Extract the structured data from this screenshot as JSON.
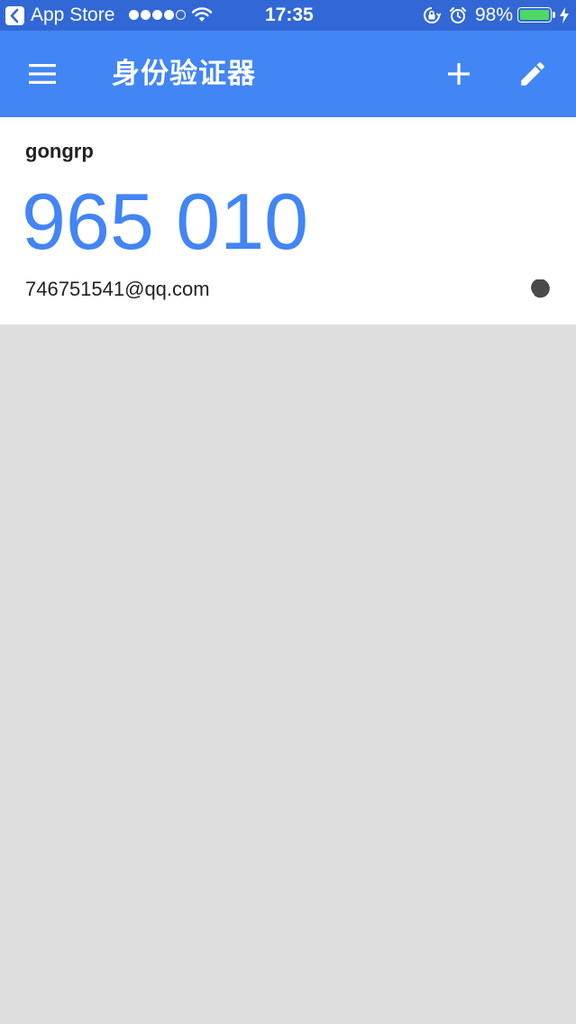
{
  "status_bar": {
    "back_app": "App Store",
    "time": "17:35",
    "battery_percent": "98%",
    "signal_bars_filled": 4,
    "signal_bars_total": 5,
    "battery_level": 0.98
  },
  "app_bar": {
    "title": "身份验证器",
    "background_color": "#4285f4"
  },
  "accounts": [
    {
      "issuer": "gongrp",
      "code": "965 010",
      "account": "746751541@qq.com"
    }
  ],
  "colors": {
    "status_bar": "#3268d6",
    "accent": "#4285f4",
    "empty_background": "#dedede"
  }
}
